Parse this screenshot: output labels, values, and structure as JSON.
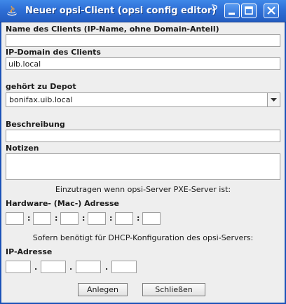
{
  "window": {
    "title": "Neuer opsi-Client (opsi config editor)"
  },
  "form": {
    "client_name": {
      "label": "Name des Clients (IP-Name, ohne Domain-Anteil)",
      "value": ""
    },
    "ip_domain": {
      "label": "IP-Domain des Clients",
      "value": "uib.local"
    },
    "depot": {
      "label": "gehört zu Depot",
      "selected": "bonifax.uib.local"
    },
    "description": {
      "label": "Beschreibung",
      "value": ""
    },
    "notes": {
      "label": "Notizen",
      "value": ""
    },
    "pxe_hint": "Einzutragen wenn opsi-Server PXE-Server ist:",
    "mac": {
      "label": "Hardware- (Mac-) Adresse",
      "octets": [
        "",
        "",
        "",
        "",
        "",
        ""
      ],
      "separator": ":"
    },
    "dhcp_hint": "Sofern benötigt für DHCP-Konfiguration des opsi-Servers:",
    "ip": {
      "label": "IP-Adresse",
      "octets": [
        "",
        "",
        "",
        ""
      ],
      "separator": "."
    }
  },
  "buttons": {
    "create": "Anlegen",
    "close": "Schließen"
  }
}
